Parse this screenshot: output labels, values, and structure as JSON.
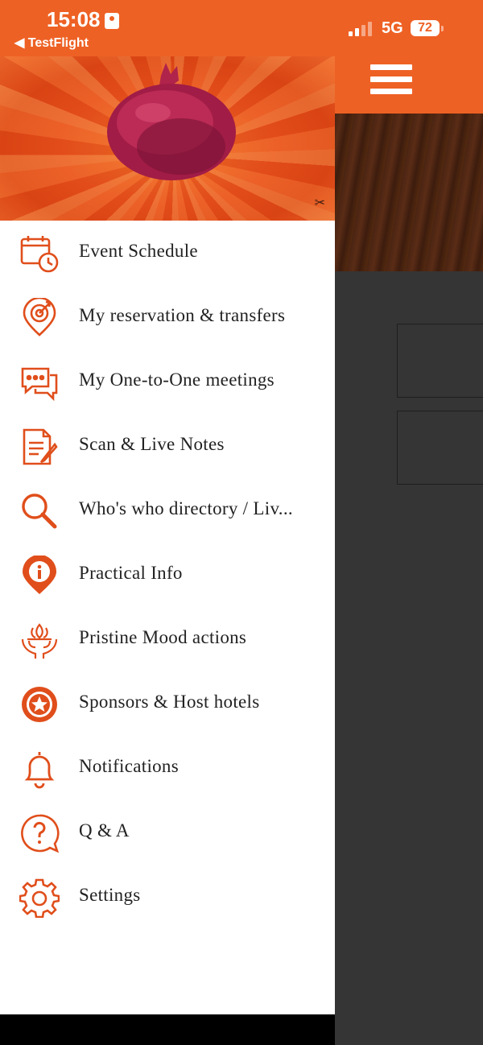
{
  "status_bar": {
    "time": "15:08",
    "back_app": "◀ TestFlight",
    "network": "5G",
    "battery": "72",
    "colors": {
      "bar": "#ee6124"
    }
  },
  "header": {
    "menu_icon": "hamburger-menu-icon"
  },
  "drawer": {
    "accent_color": "#e04e1b",
    "header_image": "pomegranate-illustration",
    "items": [
      {
        "label": "Event Schedule",
        "icon": "calendar-clock-icon"
      },
      {
        "label": "My reservation & transfers",
        "icon": "target-pin-icon"
      },
      {
        "label": "My One-to-One meetings",
        "icon": "chat-bubbles-icon"
      },
      {
        "label": "Scan & Live Notes",
        "icon": "notes-pencil-icon"
      },
      {
        "label": "Who's who directory / Liv...",
        "icon": "magnifier-icon"
      },
      {
        "label": "Practical Info",
        "icon": "info-pin-icon"
      },
      {
        "label": "Pristine Mood actions",
        "icon": "lotus-hands-icon"
      },
      {
        "label": "Sponsors & Host hotels",
        "icon": "star-badge-icon"
      },
      {
        "label": "Notifications",
        "icon": "bell-icon"
      },
      {
        "label": "Q & A",
        "icon": "question-bubble-icon"
      },
      {
        "label": "Settings",
        "icon": "gear-icon"
      }
    ]
  }
}
